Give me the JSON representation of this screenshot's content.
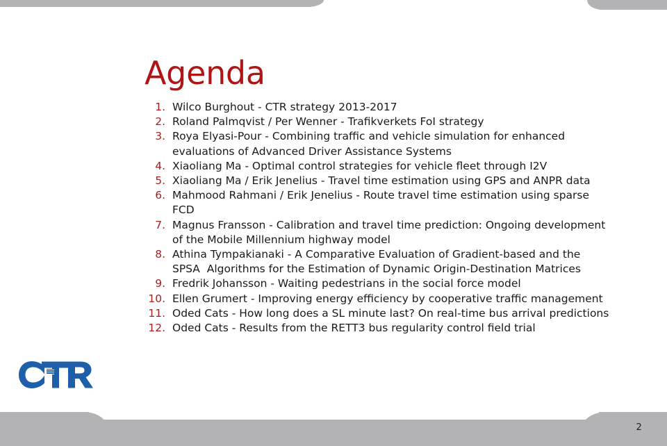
{
  "slide": {
    "title": "Agenda",
    "page_number": "2",
    "title_color": "#b01515",
    "number_color": "#a62020",
    "band_color": "#b3b3b6",
    "logo": {
      "name": "ctr-logo",
      "text": "CTR",
      "color": "#1f5fa9"
    },
    "agenda": [
      {
        "number": "1.",
        "text": "Wilco Burghout - CTR strategy 2013-2017"
      },
      {
        "number": "2.",
        "text": "Roland Palmqvist / Per Wenner - Trafikverkets FoI strategy"
      },
      {
        "number": "3.",
        "text": "Roya Elyasi-Pour - Combining traffic and vehicle simulation for enhanced evaluations of Advanced Driver Assistance Systems"
      },
      {
        "number": "4.",
        "text": "Xiaoliang Ma - Optimal control strategies for vehicle fleet through I2V"
      },
      {
        "number": "5.",
        "text": "Xiaoliang Ma / Erik Jenelius - Travel time estimation using GPS and ANPR data"
      },
      {
        "number": "6.",
        "text": "Mahmood Rahmani / Erik Jenelius - Route travel time estimation using sparse FCD"
      },
      {
        "number": "7.",
        "text": "Magnus Fransson - Calibration and travel time prediction: Ongoing development of the Mobile Millennium highway model"
      },
      {
        "number": "8.",
        "text": "Athina Tympakianaki - A Comparative Evaluation of Gradient-based and the SPSA  Algorithms for the Estimation of Dynamic Origin-Destination Matrices"
      },
      {
        "number": "9.",
        "text": "Fredrik Johansson - Waiting pedestrians in the social force model"
      },
      {
        "number": "10.",
        "text": "Ellen Grumert - Improving energy efficiency by cooperative traffic management"
      },
      {
        "number": "11.",
        "text": "Oded Cats - How long does a SL minute last? On real-time bus arrival predictions"
      },
      {
        "number": "12.",
        "text": "Oded Cats - Results from the RETT3 bus regularity control field trial"
      }
    ]
  }
}
